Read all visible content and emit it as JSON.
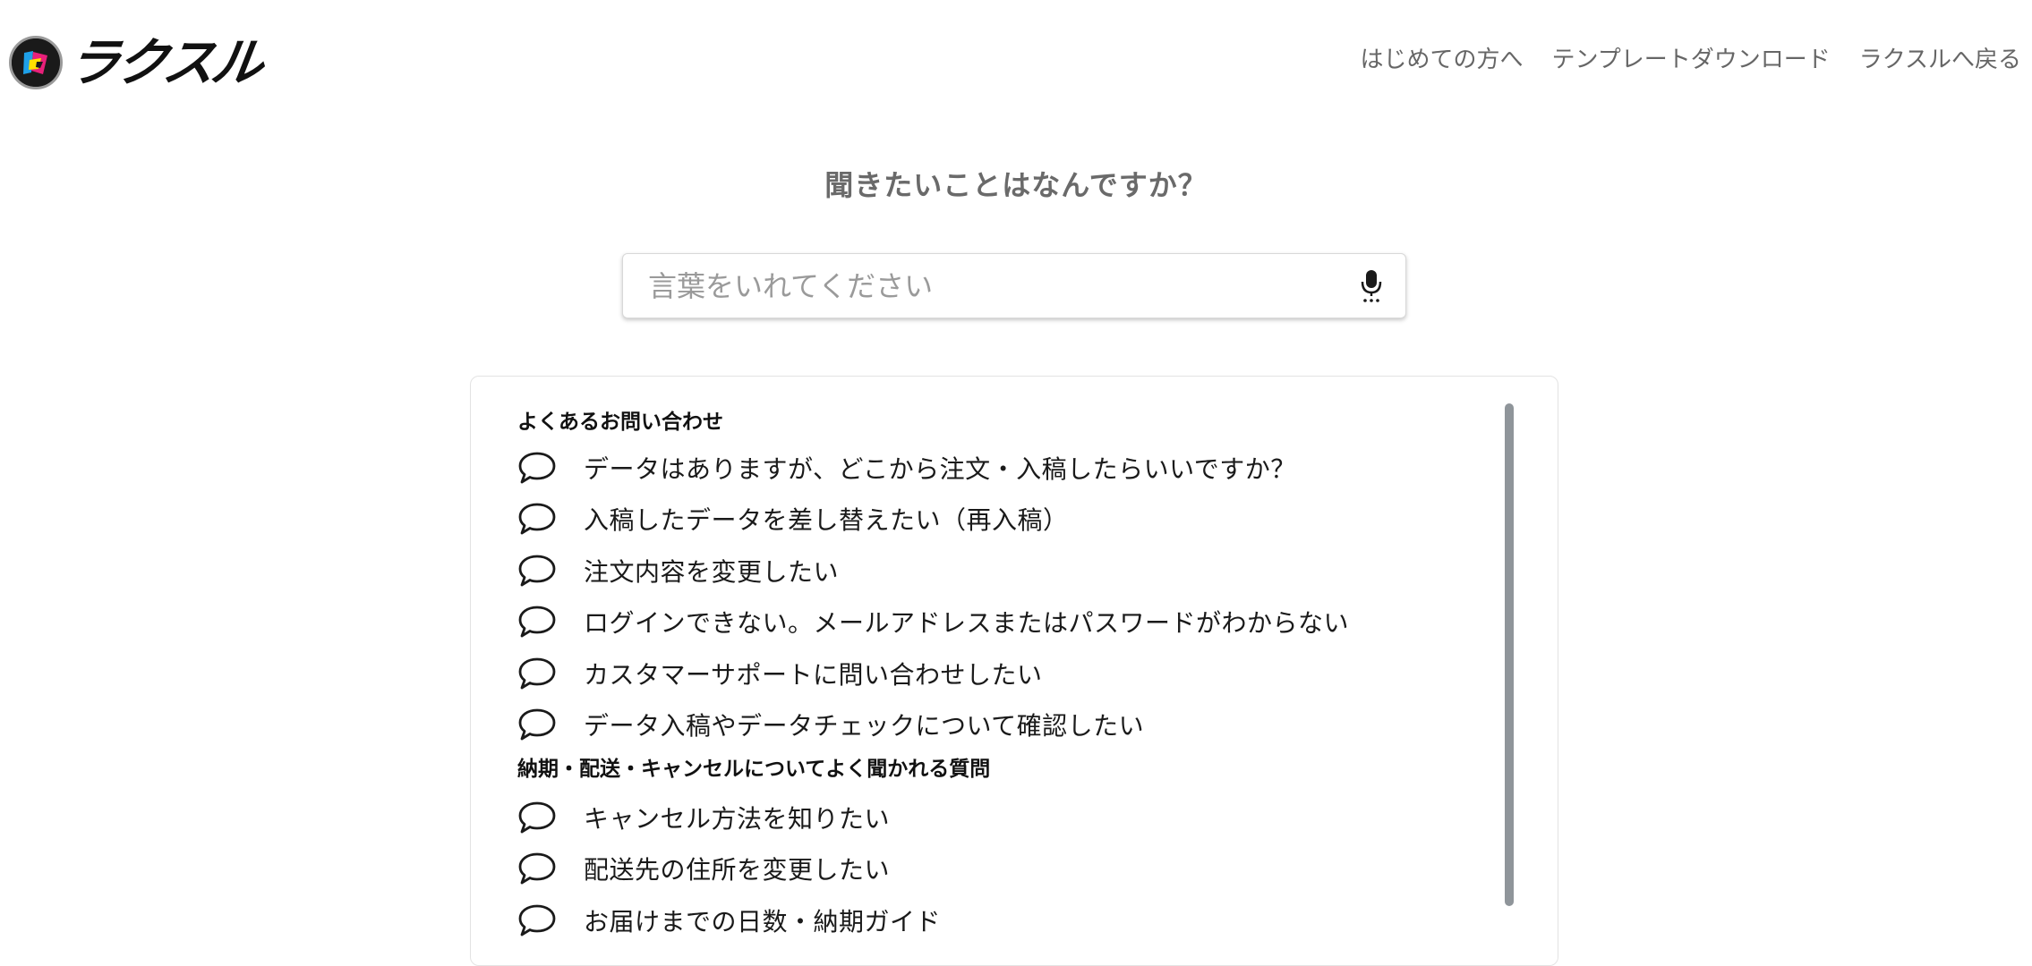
{
  "brand": {
    "name": "ラクスル",
    "logo_icon": "raksul-logo-icon",
    "colors": {
      "cyan": "#1ea0e8",
      "magenta": "#e8207a",
      "yellow": "#ffe000",
      "dark": "#1a1a1a"
    }
  },
  "nav": {
    "items": [
      {
        "label": "はじめての方へ"
      },
      {
        "label": "テンプレートダウンロード"
      },
      {
        "label": "ラクスルへ戻る"
      }
    ]
  },
  "heading": "聞きたいことはなんですか？",
  "search": {
    "placeholder": "言葉をいれてください",
    "value": "",
    "mic_icon": "microphone-icon"
  },
  "sections": [
    {
      "title": "よくあるお問い合わせ",
      "items": [
        {
          "label": "データはありますが、どこから注文・入稿したらいいですか？"
        },
        {
          "label": "入稿したデータを差し替えたい（再入稿）"
        },
        {
          "label": "注文内容を変更したい"
        },
        {
          "label": "ログインできない。メールアドレスまたはパスワードがわからない"
        },
        {
          "label": "カスタマーサポートに問い合わせしたい"
        },
        {
          "label": "データ入稿やデータチェックについて確認したい"
        }
      ]
    },
    {
      "title": "納期・配送・キャンセルについてよく聞かれる質問",
      "items": [
        {
          "label": "キャンセル方法を知りたい"
        },
        {
          "label": "配送先の住所を変更したい"
        },
        {
          "label": "お届けまでの日数・納期ガイド"
        }
      ]
    }
  ],
  "item_icon": "speech-bubble-icon"
}
